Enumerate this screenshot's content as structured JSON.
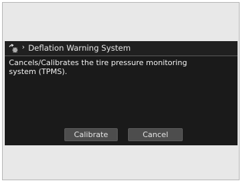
{
  "header": {
    "icon": "settings-gear-icon",
    "separator": "›",
    "title": "Deflation Warning System"
  },
  "body": {
    "description": "Cancels/Calibrates the tire pressure monitoring system (TPMS)."
  },
  "actions": {
    "calibrate_label": "Calibrate",
    "cancel_label": "Cancel"
  },
  "colors": {
    "screen_background": "#1a1a1a",
    "button_background": "#4d4d4d",
    "text": "#f2f2f2",
    "outer_panel": "#e8e8e8"
  }
}
